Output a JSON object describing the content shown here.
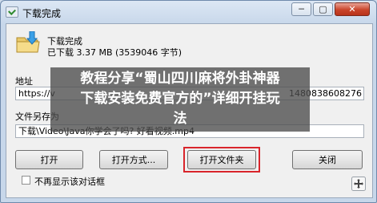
{
  "window": {
    "title": "下载完成",
    "buttons": {
      "minimize": "─",
      "maximize": "▢",
      "close": "✕"
    }
  },
  "status": {
    "title": "下载完成",
    "size_line": "已下载 3.37 MB (3539046 字节)"
  },
  "address": {
    "label": "地址",
    "value_start": "https://v",
    "value_end": "1480838608276"
  },
  "save_as": {
    "label": "文件另存为",
    "value": "下载\\Video\\Java你学会了吗? 好看视频.mp4"
  },
  "buttons": {
    "open": "打开",
    "open_with": "打开方式...",
    "open_folder": "打开文件夹",
    "close": "关闭"
  },
  "checkbox": {
    "label": "不再显示该对话框",
    "checked": false
  },
  "banner": {
    "line1": "教程分享“蜀山四川麻将外卦神器",
    "line2": "下载安装免费官方的”详细开挂玩",
    "line3": "法"
  },
  "colors": {
    "highlight": "#d9252b",
    "close_button": "#c9442a"
  }
}
